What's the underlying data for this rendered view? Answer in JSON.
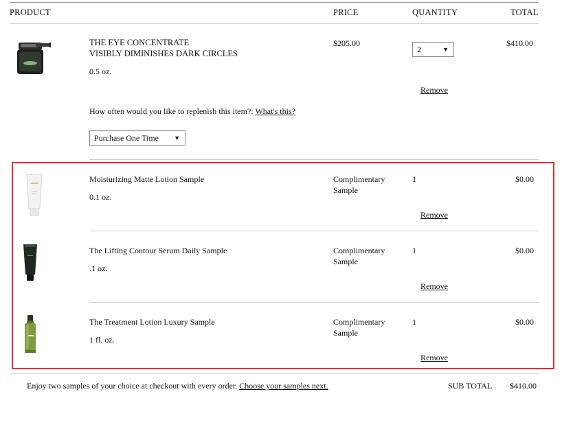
{
  "header": {
    "product": "PRODUCT",
    "price": "PRICE",
    "quantity": "QUANTITY",
    "total": "TOTAL"
  },
  "main_item": {
    "name_line1": "THE EYE CONCENTRATE",
    "name_line2": "VISIBLY DIMINISHES DARK CIRCLES",
    "size": "0.5 oz.",
    "price": "$205.00",
    "quantity": "2",
    "total": "$410.00",
    "remove": "Remove",
    "replenish_question": "How often would you like to replenish this item?:",
    "whats_this": "What's this?",
    "replenish_option": "Purchase One Time"
  },
  "samples": [
    {
      "name": "Moisturizing Matte Lotion Sample",
      "size": "0.1 oz.",
      "price_line1": "Complimentary",
      "price_line2": "Sample",
      "quantity": "1",
      "total": "$0.00",
      "remove": "Remove"
    },
    {
      "name": "The Lifting Contour Serum Daily Sample",
      "size": ".1 oz.",
      "price_line1": "Complimentary",
      "price_line2": "Sample",
      "quantity": "1",
      "total": "$0.00",
      "remove": "Remove"
    },
    {
      "name": "The Treatment Lotion Luxury Sample",
      "size": "1 fl. oz.",
      "price_line1": "Complimentary",
      "price_line2": "Sample",
      "quantity": "1",
      "total": "$0.00",
      "remove": "Remove"
    }
  ],
  "footer": {
    "samples_text": "Enjoy two samples of your choice at checkout with every order.",
    "samples_link": "Choose your samples next.",
    "subtotal_label": "SUB TOTAL",
    "subtotal_value": "$410.00"
  },
  "colors": {
    "highlight_border": "#e0313a",
    "divider": "#cfcfcf"
  },
  "icons": {
    "dropdown": "triangle-down",
    "eye_concentrate": "dark-jar-with-applicator",
    "matte_lotion": "white-tube",
    "serum": "dark-green-tube",
    "treatment_lotion": "green-bottle"
  }
}
